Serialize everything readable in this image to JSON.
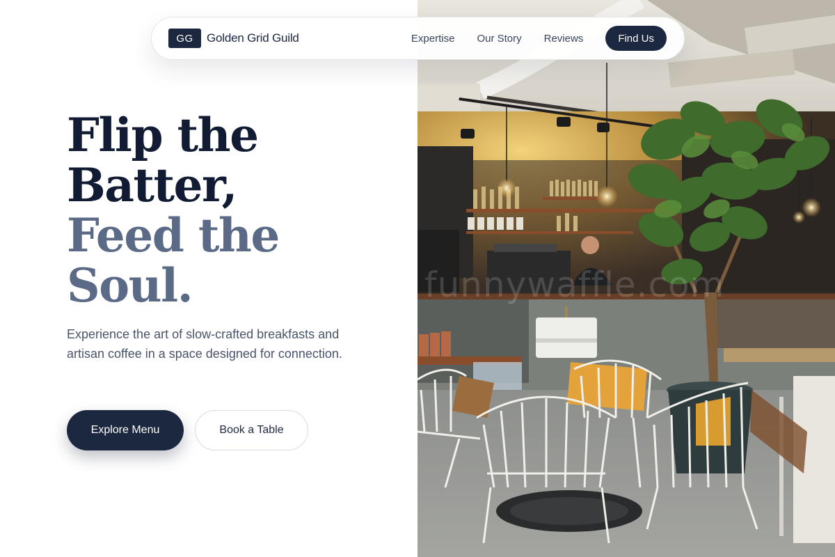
{
  "nav": {
    "logo_mark": "GG",
    "brand_name": "Golden Grid Guild",
    "links": [
      "Expertise",
      "Our Story",
      "Reviews"
    ],
    "cta_label": "Find Us"
  },
  "hero": {
    "headline_lines": [
      "Flip the",
      "Batter,",
      "Feed the",
      "Soul."
    ],
    "description": "Experience the art of slow-crafted breakfasts and artisan coffee in a space designed for connection.",
    "primary_button": "Explore Menu",
    "secondary_button": "Book a Table"
  },
  "photo": {
    "watermark": "funnywaffle.com"
  },
  "colors": {
    "primary": "#1c2740",
    "muted_heading": "#5b6b87",
    "body_text": "#4a5468"
  }
}
